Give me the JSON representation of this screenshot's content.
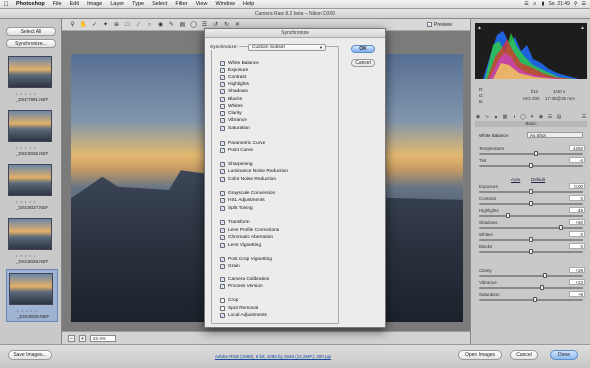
{
  "menubar": {
    "app": "Photoshop",
    "items": [
      "File",
      "Edit",
      "Image",
      "Layer",
      "Type",
      "Select",
      "Filter",
      "View",
      "Window",
      "Help"
    ],
    "clock": "So. 21:49"
  },
  "window": {
    "title": "Camera Raw 8.2 beta  –  Nikon D300"
  },
  "toolbar": {
    "preview_label": "Preview"
  },
  "filmstrip": {
    "select_all": "Select All",
    "synchronize": "Synchronize...",
    "thumbs": [
      {
        "name": "_DSC7981.NEF"
      },
      {
        "name": "_DSC8026.NEF"
      },
      {
        "name": "_DSC8027.NEF"
      },
      {
        "name": "_DSC8028.NEF"
      },
      {
        "name": "_DSC8030.NEF"
      }
    ]
  },
  "status": {
    "zoom": "22.4%"
  },
  "camera_info": {
    "r": "R:",
    "g": "G:",
    "b": "B:",
    "aperture": "f/11",
    "shutter": "1/40 s",
    "iso": "ISO 200",
    "lens": "17-35@35 mm"
  },
  "basic": {
    "title": "Basic",
    "wb_label": "White Balance:",
    "wb_value": "As Shot",
    "auto": "Auto",
    "default": "Default",
    "sliders": [
      {
        "label": "Temperature",
        "value": "4250",
        "pos": 0.55
      },
      {
        "label": "Tint",
        "value": "-4",
        "pos": 0.5
      },
      {
        "label": "Exposure",
        "value": "0.00",
        "pos": 0.5
      },
      {
        "label": "Contrast",
        "value": "0",
        "pos": 0.5
      },
      {
        "label": "Highlights",
        "value": "-49",
        "pos": 0.27
      },
      {
        "label": "Shadows",
        "value": "+60",
        "pos": 0.8
      },
      {
        "label": "Whites",
        "value": "0",
        "pos": 0.5
      },
      {
        "label": "Blacks",
        "value": "0",
        "pos": 0.5
      },
      {
        "label": "Clarity",
        "value": "+28",
        "pos": 0.64
      },
      {
        "label": "Vibrance",
        "value": "+23",
        "pos": 0.61
      },
      {
        "label": "Saturation",
        "value": "+8",
        "pos": 0.54
      }
    ]
  },
  "dialog": {
    "title": "Synchronize",
    "sync_label": "Synchronize:",
    "sync_value": "Custom Subset",
    "ok": "OK",
    "cancel": "Cancel",
    "items": [
      {
        "label": "White Balance",
        "checked": true
      },
      {
        "label": "Exposure",
        "checked": true
      },
      {
        "label": "Contrast",
        "checked": true
      },
      {
        "label": "Highlights",
        "checked": true
      },
      {
        "label": "Shadows",
        "checked": true
      },
      {
        "label": "Blacks",
        "checked": true
      },
      {
        "label": "Whites",
        "checked": true
      },
      {
        "label": "Clarity",
        "checked": true
      },
      {
        "label": "Vibrance",
        "checked": true
      },
      {
        "label": "Saturation",
        "checked": true
      },
      {
        "label": "Parametric Curve",
        "checked": true
      },
      {
        "label": "Point Curve",
        "checked": true
      },
      {
        "label": "Sharpening",
        "checked": true
      },
      {
        "label": "Luminance Noise Reduction",
        "checked": true
      },
      {
        "label": "Color Noise Reduction",
        "checked": true
      },
      {
        "label": "Grayscale Conversion",
        "checked": true
      },
      {
        "label": "HSL Adjustments",
        "checked": true
      },
      {
        "label": "Split Toning",
        "checked": true
      },
      {
        "label": "Transform",
        "checked": true
      },
      {
        "label": "Lens Profile Corrections",
        "checked": true
      },
      {
        "label": "Chromatic Aberration",
        "checked": true
      },
      {
        "label": "Lens Vignetting",
        "checked": true
      },
      {
        "label": "Post Crop Vignetting",
        "checked": true
      },
      {
        "label": "Grain",
        "checked": true
      },
      {
        "label": "Camera Calibration",
        "checked": true
      },
      {
        "label": "Process Version",
        "checked": true
      },
      {
        "label": "Crop",
        "checked": false
      },
      {
        "label": "Spot Removal",
        "checked": false
      },
      {
        "label": "Local Adjustments",
        "checked": true
      }
    ]
  },
  "bottom": {
    "save": "Save Images...",
    "workflow": "Adobe RGB (1998); 8 bit; 4288 by 2848 (12.2MP); 300 ppi",
    "open": "Open Images",
    "cancel": "Cancel",
    "done": "Done"
  }
}
